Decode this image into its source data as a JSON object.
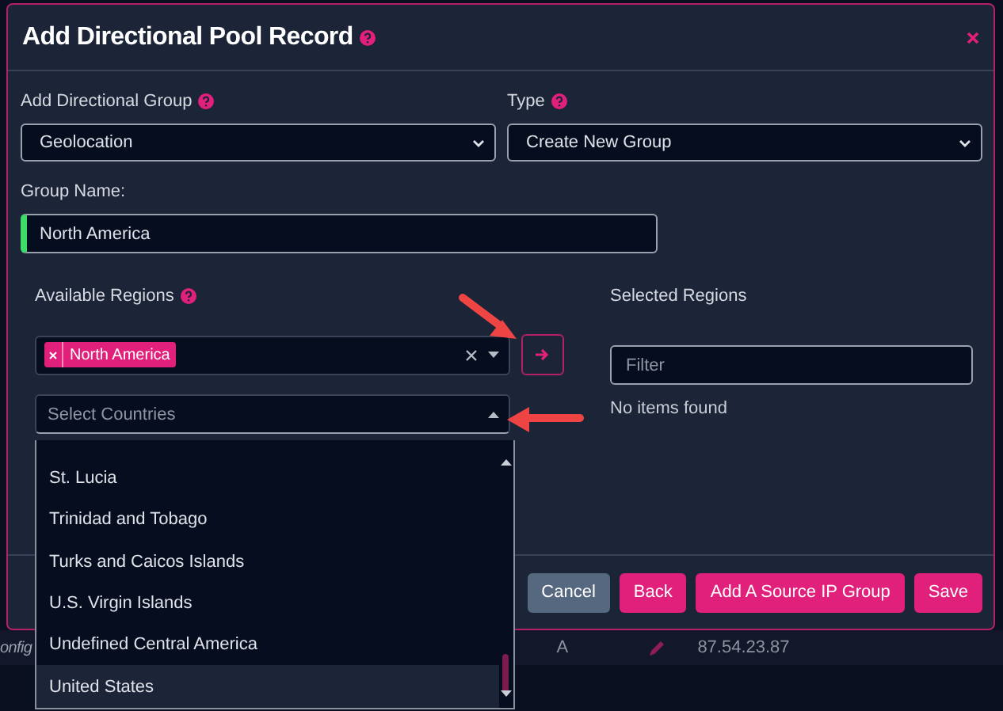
{
  "background_row": {
    "column_1": "onfig",
    "column_2": "A",
    "column_3": "87.54.23.87"
  },
  "dialog": {
    "title": "Add Directional Pool Record",
    "directional_group": {
      "label": "Add Directional Group",
      "value": "Geolocation"
    },
    "type": {
      "label": "Type",
      "value": "Create New Group"
    },
    "group_name": {
      "label": "Group Name:",
      "value": "North America"
    },
    "available_regions": {
      "label": "Available Regions",
      "chips": [
        "North America"
      ],
      "countries_placeholder": "Select Countries",
      "countries_expanded": true,
      "countries": [
        {
          "label": "St. Lucia",
          "selected": false
        },
        {
          "label": "Trinidad and Tobago",
          "selected": false
        },
        {
          "label": "Turks and Caicos Islands",
          "selected": false
        },
        {
          "label": "U.S. Virgin Islands",
          "selected": false
        },
        {
          "label": "Undefined Central America",
          "selected": false
        },
        {
          "label": "United States",
          "selected": true
        }
      ]
    },
    "selected_regions": {
      "label": "Selected Regions",
      "filter_placeholder": "Filter",
      "empty_text": "No items found"
    },
    "buttons": [
      {
        "label": "Cancel",
        "kind": "secondary"
      },
      {
        "label": "Back",
        "kind": "primary"
      },
      {
        "label": "Add A Source IP Group",
        "kind": "primary"
      },
      {
        "label": "Save",
        "kind": "primary"
      }
    ]
  }
}
